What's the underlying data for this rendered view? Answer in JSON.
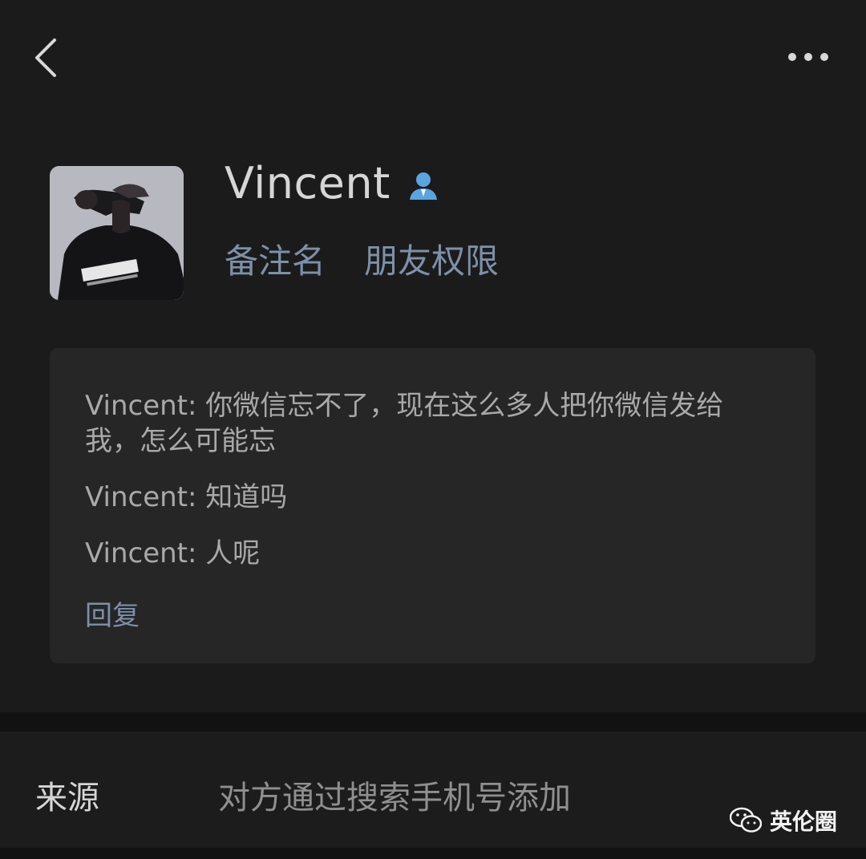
{
  "nav": {
    "back_icon": "chevron-left-icon",
    "more_icon": "more-dots-icon"
  },
  "profile": {
    "name": "Vincent",
    "friend_icon": "person-badge-icon",
    "actions": {
      "remark_label": "备注名",
      "permission_label": "朋友权限"
    },
    "accent_color": "#7d90a9"
  },
  "messages": [
    {
      "text": "Vincent: 你微信忘不了，现在这么多人把你微信发给我，怎么可能忘"
    },
    {
      "text": "Vincent: 知道吗"
    },
    {
      "text": "Vincent: 人呢"
    }
  ],
  "reply_label": "回复",
  "source": {
    "label": "来源",
    "value": "对方通过搜索手机号添加"
  },
  "watermark": {
    "icon": "wechat-icon",
    "text": "英伦圈"
  }
}
